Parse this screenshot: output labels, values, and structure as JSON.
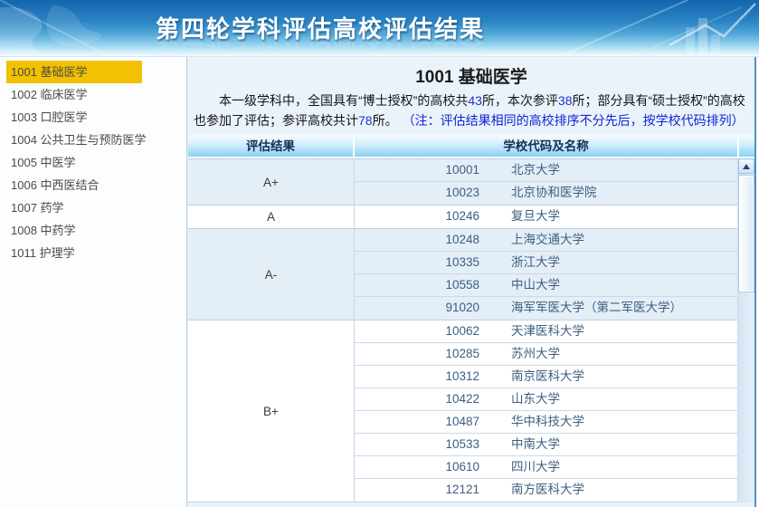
{
  "banner": {
    "title": "第四轮学科评估高校评估结果"
  },
  "sidebar": {
    "items": [
      {
        "code": "1001",
        "name": "基础医学",
        "selected": true
      },
      {
        "code": "1002",
        "name": "临床医学",
        "selected": false
      },
      {
        "code": "1003",
        "name": "口腔医学",
        "selected": false
      },
      {
        "code": "1004",
        "name": "公共卫生与预防医学",
        "selected": false
      },
      {
        "code": "1005",
        "name": "中医学",
        "selected": false
      },
      {
        "code": "1006",
        "name": "中西医结合",
        "selected": false
      },
      {
        "code": "1007",
        "name": "药学",
        "selected": false
      },
      {
        "code": "1008",
        "name": "中药学",
        "selected": false
      },
      {
        "code": "1011",
        "name": "护理学",
        "selected": false
      }
    ]
  },
  "main": {
    "title": "1001 基础医学",
    "intro": {
      "seg1": "本一级学科中，全国具有“博士授权”的高校共",
      "num1": "43",
      "seg2": "所，本次参评",
      "num2": "38",
      "seg3": "所；部分具有“硕士授权”的高校也参加了评估；参评高校共计",
      "num3": "78",
      "seg4": "所。",
      "note": "（注：评估结果相同的高校排序不分先后，按学校代码排列）"
    },
    "table": {
      "headers": [
        "评估结果",
        "学校代码及名称"
      ],
      "groups": [
        {
          "grade": "A+",
          "schools": [
            {
              "code": "10001",
              "name": "北京大学"
            },
            {
              "code": "10023",
              "name": "北京协和医学院"
            }
          ]
        },
        {
          "grade": "A",
          "schools": [
            {
              "code": "10246",
              "name": "复旦大学"
            }
          ]
        },
        {
          "grade": "A-",
          "schools": [
            {
              "code": "10248",
              "name": "上海交通大学"
            },
            {
              "code": "10335",
              "name": "浙江大学"
            },
            {
              "code": "10558",
              "name": "中山大学"
            },
            {
              "code": "91020",
              "name": "海军军医大学（第二军医大学）"
            }
          ]
        },
        {
          "grade": "B+",
          "schools": [
            {
              "code": "10062",
              "name": "天津医科大学"
            },
            {
              "code": "10285",
              "name": "苏州大学"
            },
            {
              "code": "10312",
              "name": "南京医科大学"
            },
            {
              "code": "10422",
              "name": "山东大学"
            },
            {
              "code": "10487",
              "name": "华中科技大学"
            },
            {
              "code": "10533",
              "name": "中南大学"
            },
            {
              "code": "10610",
              "name": "四川大学"
            },
            {
              "code": "12121",
              "name": "南方医科大学"
            }
          ]
        }
      ]
    }
  },
  "colors": {
    "banner_top": "#1365ad",
    "banner_bottom": "#f2fbff",
    "sidebar_highlight": "#f2c101",
    "header_gradient_bottom": "#8bd1f5",
    "row_shaded": "#e4eef6",
    "note_blue": "#1322d9",
    "school_text": "#3c5e80",
    "panel_bg": "#ebf3fa"
  }
}
